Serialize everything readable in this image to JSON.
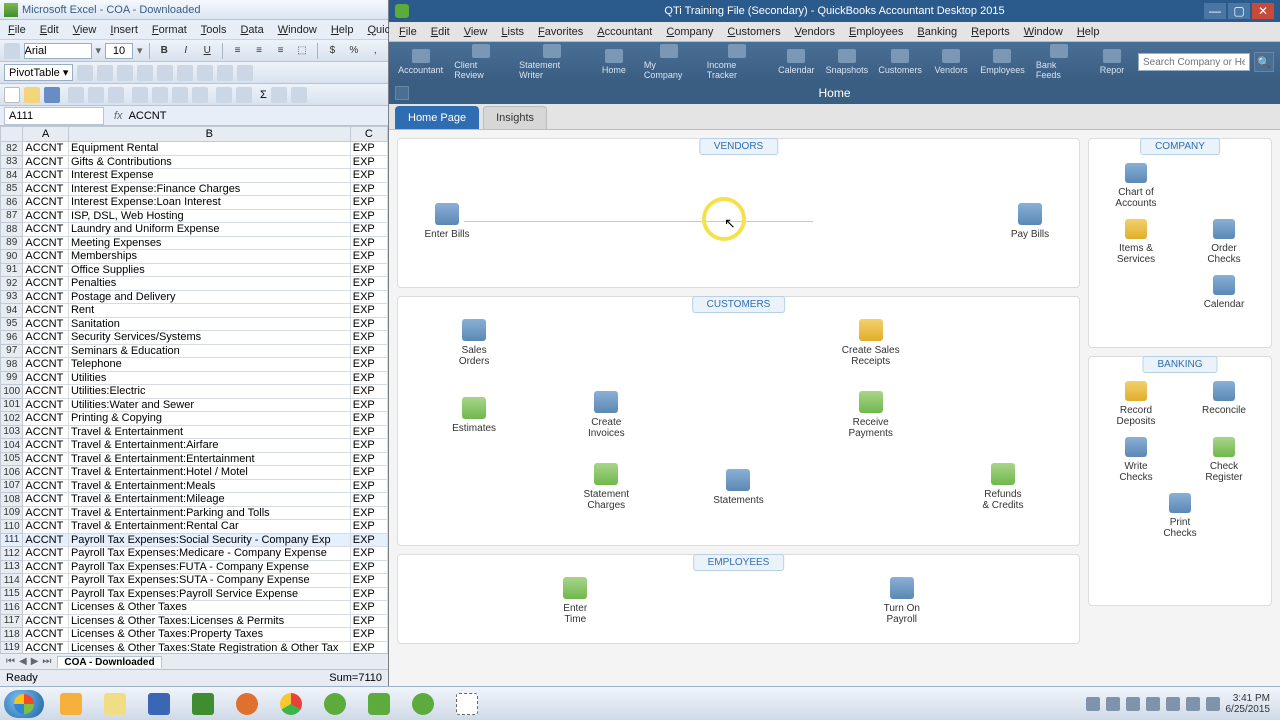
{
  "excel": {
    "title": "Microsoft Excel - COA - Downloaded",
    "menus": [
      "File",
      "Edit",
      "View",
      "Insert",
      "Format",
      "Tools",
      "Data",
      "Window",
      "Help",
      "QuickBo"
    ],
    "font_name": "Arial",
    "font_size": "10",
    "pivot_label": "PivotTable",
    "namebox": "A111",
    "fx_label": "fx",
    "formula_value": "ACCNT",
    "col_headers": [
      "",
      "A",
      "B",
      "C"
    ],
    "rows": [
      {
        "n": 82,
        "a": "ACCNT",
        "b": "Equipment Rental",
        "c": "EXP"
      },
      {
        "n": 83,
        "a": "ACCNT",
        "b": "Gifts & Contributions",
        "c": "EXP"
      },
      {
        "n": 84,
        "a": "ACCNT",
        "b": "Interest Expense",
        "c": "EXP"
      },
      {
        "n": 85,
        "a": "ACCNT",
        "b": "Interest Expense:Finance Charges",
        "c": "EXP"
      },
      {
        "n": 86,
        "a": "ACCNT",
        "b": "Interest Expense:Loan Interest",
        "c": "EXP"
      },
      {
        "n": 87,
        "a": "ACCNT",
        "b": "ISP, DSL, Web Hosting",
        "c": "EXP"
      },
      {
        "n": 88,
        "a": "ACCNT",
        "b": "Laundry and Uniform Expense",
        "c": "EXP"
      },
      {
        "n": 89,
        "a": "ACCNT",
        "b": "Meeting Expenses",
        "c": "EXP"
      },
      {
        "n": 90,
        "a": "ACCNT",
        "b": "Memberships",
        "c": "EXP"
      },
      {
        "n": 91,
        "a": "ACCNT",
        "b": "Office Supplies",
        "c": "EXP"
      },
      {
        "n": 92,
        "a": "ACCNT",
        "b": "Penalties",
        "c": "EXP"
      },
      {
        "n": 93,
        "a": "ACCNT",
        "b": "Postage and Delivery",
        "c": "EXP"
      },
      {
        "n": 94,
        "a": "ACCNT",
        "b": "Rent",
        "c": "EXP"
      },
      {
        "n": 95,
        "a": "ACCNT",
        "b": "Sanitation",
        "c": "EXP"
      },
      {
        "n": 96,
        "a": "ACCNT",
        "b": "Security Services/Systems",
        "c": "EXP"
      },
      {
        "n": 97,
        "a": "ACCNT",
        "b": "Seminars & Education",
        "c": "EXP"
      },
      {
        "n": 98,
        "a": "ACCNT",
        "b": "Telephone",
        "c": "EXP"
      },
      {
        "n": 99,
        "a": "ACCNT",
        "b": "Utilities",
        "c": "EXP"
      },
      {
        "n": 100,
        "a": "ACCNT",
        "b": "Utilities:Electric",
        "c": "EXP"
      },
      {
        "n": 101,
        "a": "ACCNT",
        "b": "Utilities:Water and Sewer",
        "c": "EXP"
      },
      {
        "n": 102,
        "a": "ACCNT",
        "b": "Printing & Copying",
        "c": "EXP"
      },
      {
        "n": 103,
        "a": "ACCNT",
        "b": "Travel & Entertainment",
        "c": "EXP"
      },
      {
        "n": 104,
        "a": "ACCNT",
        "b": "Travel & Entertainment:Airfare",
        "c": "EXP"
      },
      {
        "n": 105,
        "a": "ACCNT",
        "b": "Travel & Entertainment:Entertainment",
        "c": "EXP"
      },
      {
        "n": 106,
        "a": "ACCNT",
        "b": "Travel & Entertainment:Hotel / Motel",
        "c": "EXP"
      },
      {
        "n": 107,
        "a": "ACCNT",
        "b": "Travel & Entertainment:Meals",
        "c": "EXP"
      },
      {
        "n": 108,
        "a": "ACCNT",
        "b": "Travel & Entertainment:Mileage",
        "c": "EXP"
      },
      {
        "n": 109,
        "a": "ACCNT",
        "b": "Travel & Entertainment:Parking and Tolls",
        "c": "EXP"
      },
      {
        "n": 110,
        "a": "ACCNT",
        "b": "Travel & Entertainment:Rental Car",
        "c": "EXP"
      },
      {
        "n": 111,
        "a": "ACCNT",
        "b": "Payroll Tax Expenses:Social Security - Company Exp",
        "c": "EXP",
        "sel": true
      },
      {
        "n": 112,
        "a": "ACCNT",
        "b": "Payroll Tax Expenses:Medicare - Company Expense",
        "c": "EXP"
      },
      {
        "n": 113,
        "a": "ACCNT",
        "b": "Payroll Tax Expenses:FUTA - Company Expense",
        "c": "EXP"
      },
      {
        "n": 114,
        "a": "ACCNT",
        "b": "Payroll Tax Expenses:SUTA - Company Expense",
        "c": "EXP"
      },
      {
        "n": 115,
        "a": "ACCNT",
        "b": "Payroll Tax Expenses:Payroll Service Expense",
        "c": "EXP"
      },
      {
        "n": 116,
        "a": "ACCNT",
        "b": "Licenses & Other Taxes",
        "c": "EXP"
      },
      {
        "n": 117,
        "a": "ACCNT",
        "b": "Licenses & Other Taxes:Licenses & Permits",
        "c": "EXP"
      },
      {
        "n": 118,
        "a": "ACCNT",
        "b": "Licenses & Other Taxes:Property Taxes",
        "c": "EXP"
      },
      {
        "n": 119,
        "a": "ACCNT",
        "b": "Licenses & Other Taxes:State Registration & Other Tax",
        "c": "EXP"
      }
    ],
    "sheet_tab": "COA - Downloaded",
    "status_left": "Ready",
    "status_right": "Sum=7110"
  },
  "qb": {
    "title": "QTi Training File (Secondary) - QuickBooks Accountant Desktop 2015",
    "menus": [
      "File",
      "Edit",
      "View",
      "Lists",
      "Favorites",
      "Accountant",
      "Company",
      "Customers",
      "Vendors",
      "Employees",
      "Banking",
      "Reports",
      "Window",
      "Help"
    ],
    "iconbar": [
      "Accountant",
      "Client Review",
      "Statement Writer",
      "Home",
      "My Company",
      "Income Tracker",
      "Calendar",
      "Snapshots",
      "Customers",
      "Vendors",
      "Employees",
      "Bank Feeds",
      "Repor"
    ],
    "search_placeholder": "Search Company or Help",
    "sub_title": "Home",
    "tabs": {
      "home": "Home Page",
      "insights": "Insights"
    },
    "panels": {
      "vendors": "VENDORS",
      "customers": "CUSTOMERS",
      "employees": "EMPLOYEES",
      "company": "COMPANY",
      "banking": "BANKING"
    },
    "vendors": {
      "enter": "Enter Bills",
      "pay": "Pay Bills"
    },
    "customers": {
      "sales_orders": "Sales\nOrders",
      "create_sales": "Create Sales\nReceipts",
      "estimates": "Estimates",
      "create_inv": "Create\nInvoices",
      "receive": "Receive\nPayments",
      "statement_ch": "Statement\nCharges",
      "statements": "Statements",
      "refunds": "Refunds\n& Credits"
    },
    "employees": {
      "enter_time": "Enter\nTime",
      "turn_on": "Turn On\nPayroll"
    },
    "company": {
      "coa": "Chart of\nAccounts",
      "items": "Items &\nServices",
      "order": "Order\nChecks",
      "calendar": "Calendar"
    },
    "banking": {
      "record": "Record\nDeposits",
      "reconcile": "Reconcile",
      "write": "Write\nChecks",
      "check_reg": "Check\nRegister",
      "print": "Print\nChecks"
    }
  },
  "taskbar": {
    "time": "3:41 PM",
    "date": "6/25/2015"
  }
}
